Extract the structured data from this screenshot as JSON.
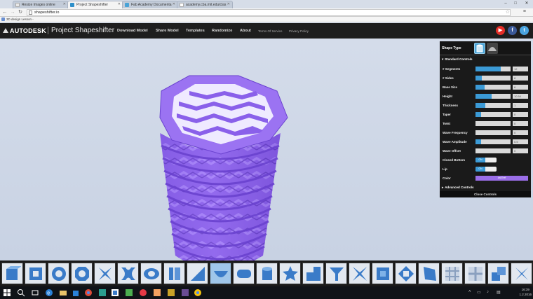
{
  "browser": {
    "tabs": [
      {
        "label": "Resize Images online",
        "active": false,
        "favicon_color": "#e8e8e8"
      },
      {
        "label": "Project Shapeshifter",
        "active": true,
        "favicon_color": "#2e8fc9"
      },
      {
        "label": "Fab Academy Documenta",
        "active": false,
        "favicon_color": "#4aa3d6"
      },
      {
        "label": "academy.cba.mit.edu/clas",
        "active": false,
        "favicon_color": "#ffffff"
      }
    ],
    "window_buttons": {
      "minimize": "–",
      "maximize": "□",
      "close": "✕"
    },
    "nav": {
      "back": "←",
      "forward": "→",
      "reload": "↻"
    },
    "url": "shapeshifter.io",
    "star": "☆",
    "menu": "≡",
    "bookmarks": [
      "3D design Lesson -"
    ]
  },
  "app": {
    "brand": "AUTODESK",
    "product": "Project Shapeshifter",
    "nav": [
      "Download Model",
      "Share Model",
      "Templates",
      "Randomize",
      "About"
    ],
    "nav_small": [
      "Terms Of Service",
      "Privacy Policy"
    ],
    "social": [
      {
        "icon": "youtube-icon",
        "glyph": "▶",
        "color": "#e52d27"
      },
      {
        "icon": "facebook-icon",
        "glyph": "f",
        "color": "#3b5998"
      },
      {
        "icon": "twitter-icon",
        "glyph": "t",
        "color": "#4aa3df"
      }
    ]
  },
  "panel": {
    "shape_type_label": "Shape Type",
    "standard_controls": "Standard Controls",
    "advanced_controls": "Advanced Controls",
    "close_controls": "Close Controls",
    "caret_open": "▾",
    "caret_closed": "▸",
    "sliders": [
      {
        "name": "# Segments",
        "value": "12",
        "fill": 0.72
      },
      {
        "name": "# Sides",
        "value": "8",
        "fill": 0.18
      },
      {
        "name": "Base Size",
        "value": "6",
        "fill": 0.26
      },
      {
        "name": "Height",
        "value": "10.54",
        "fill": 0.46
      },
      {
        "name": "Thickness",
        "value": "1",
        "fill": 0.28
      },
      {
        "name": "Taper",
        "value": "0",
        "fill": 0.16
      },
      {
        "name": "Twist",
        "value": "0",
        "fill": 0.0
      },
      {
        "name": "Wave Frequency",
        "value": "0",
        "fill": 0.0
      },
      {
        "name": "Wave Amplitude",
        "value": "0.5",
        "fill": 0.16
      },
      {
        "name": "Wave Offset",
        "value": "0",
        "fill": 0.0
      }
    ],
    "toggles": [
      {
        "name": "Closed Bottom",
        "state": "ON"
      },
      {
        "name": "Lip",
        "state": "ON"
      }
    ],
    "color": {
      "name": "Color",
      "value": "#a57eff",
      "swatch": "#9a6ee8"
    }
  },
  "taskbar": {
    "time": "16:39",
    "date": "1.2.2016"
  },
  "colors": {
    "model_purple": "#9b73f2",
    "accent_blue": "#3b9ad6"
  }
}
